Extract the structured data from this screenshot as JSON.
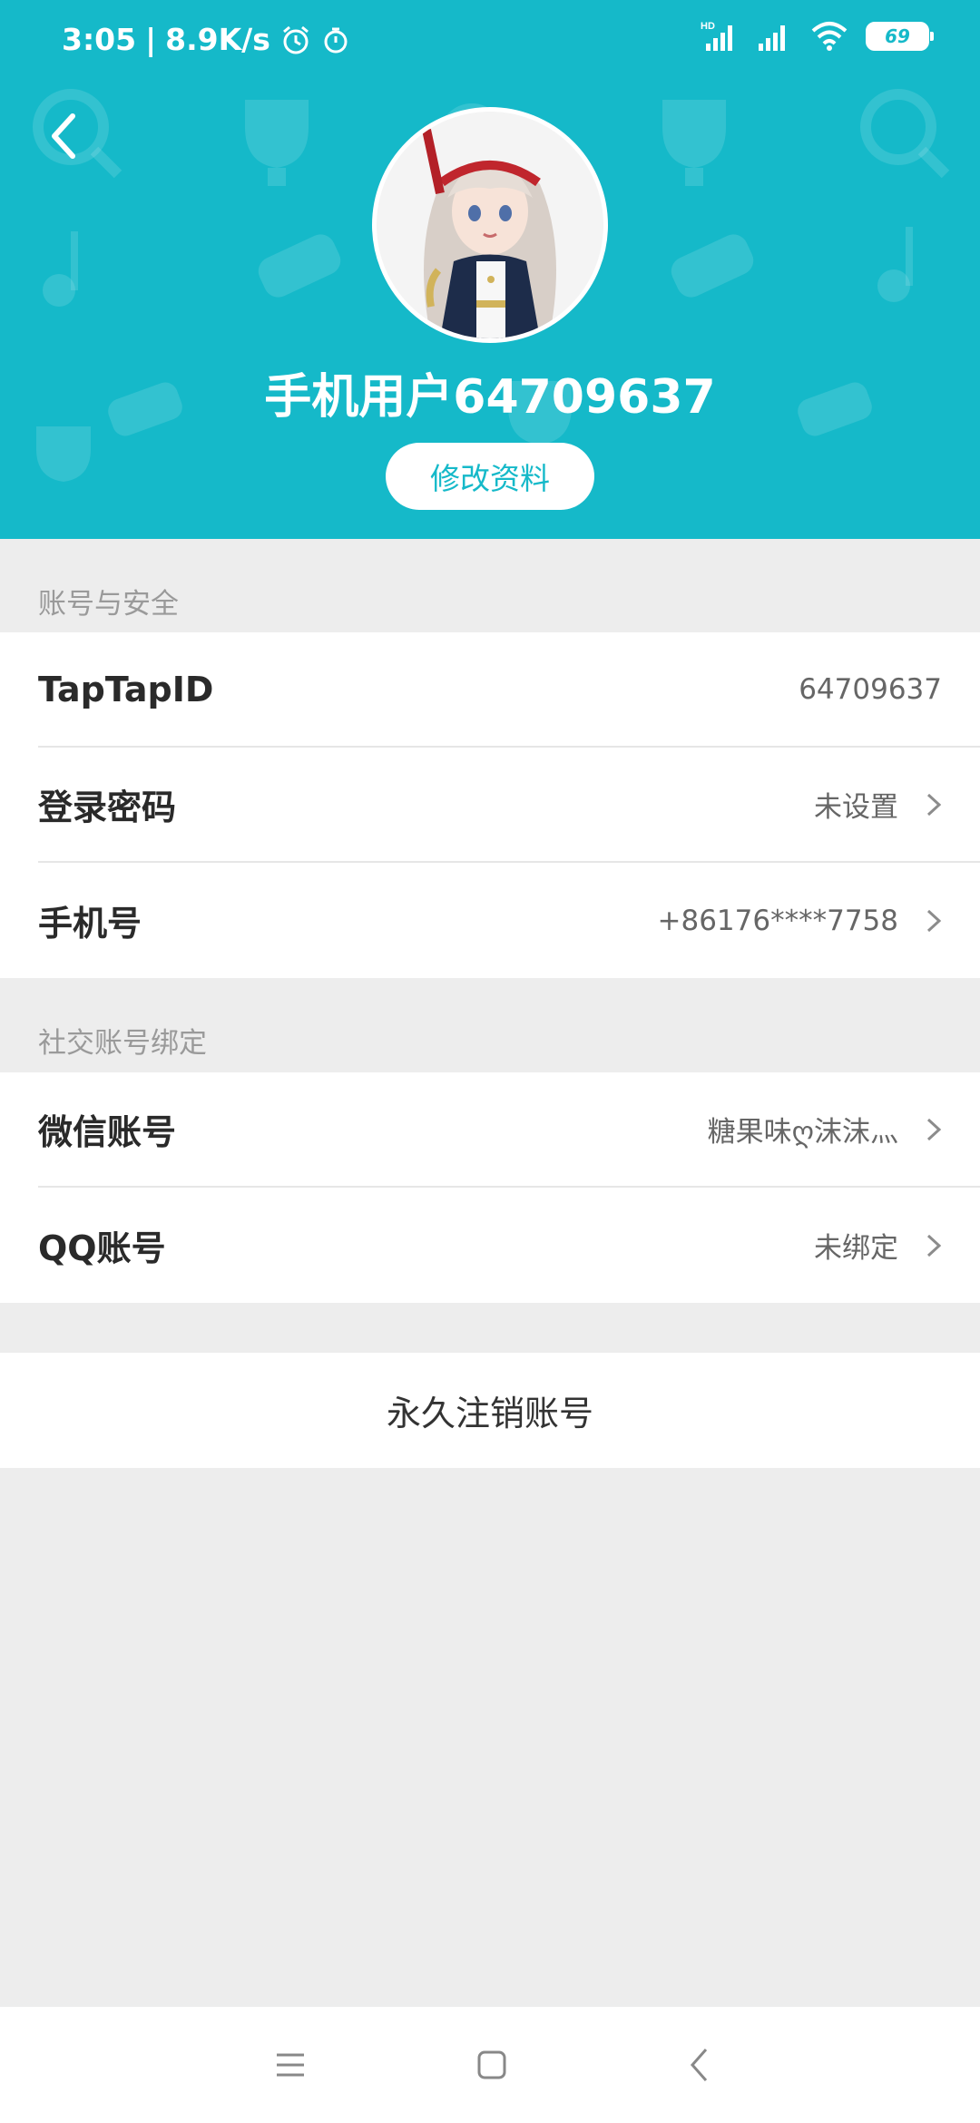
{
  "status_bar": {
    "time": "3:05",
    "separator": "|",
    "net_speed": "8.9K/s",
    "network_label": "HD",
    "battery": "69"
  },
  "header": {
    "username": "手机用户64709637",
    "edit_button": "修改资料",
    "accent_color": "#15b9c9"
  },
  "account_security": {
    "title": "账号与安全",
    "rows": [
      {
        "label": "TapTapID",
        "value": "64709637",
        "arrow": false
      },
      {
        "label": "登录密码",
        "value": "未设置",
        "arrow": true
      },
      {
        "label": "手机号",
        "value": "+86176****7758",
        "arrow": true
      }
    ]
  },
  "social_binding": {
    "title": "社交账号绑定",
    "rows": [
      {
        "label": "微信账号",
        "value": "糖果味ღ沫沫灬",
        "arrow": true
      },
      {
        "label": "QQ账号",
        "value": "未绑定",
        "arrow": true
      }
    ]
  },
  "delete_account": "永久注销账号",
  "icons": {
    "back": "back-arrow-icon",
    "alarm": "alarm-clock-icon",
    "timer": "stopwatch-icon",
    "signal": "signal-icon",
    "wifi": "wifi-icon",
    "chevron": "chevron-right-icon",
    "menu": "menu-icon",
    "home": "home-icon",
    "nav_back": "nav-back-icon"
  }
}
